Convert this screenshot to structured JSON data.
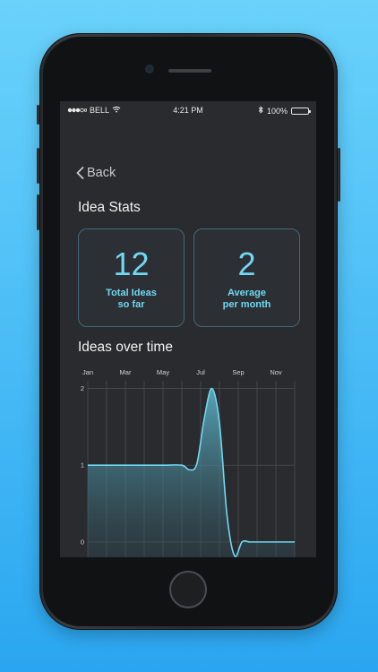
{
  "status_bar": {
    "carrier": "BELL",
    "time": "4:21 PM",
    "battery": "100%",
    "signal_icon": "signal-dots-icon",
    "wifi_icon": "wifi-icon",
    "bluetooth_icon": "bluetooth-icon"
  },
  "nav": {
    "back_label": "Back"
  },
  "stats": {
    "title": "Idea Stats",
    "total": {
      "value": "12",
      "label_line1": "Total Ideas",
      "label_line2": "so far"
    },
    "average": {
      "value": "2",
      "label_line1": "Average",
      "label_line2": "per month"
    }
  },
  "chart_section": {
    "title": "Ideas over time"
  },
  "colors": {
    "accent": "#6fd8f3",
    "screen_bg": "#2a2b2e",
    "card_border": "#3f6a7b",
    "background_gradient_top": "#6ad2fb",
    "background_gradient_bottom": "#2aa6f0"
  },
  "chart_data": {
    "type": "area",
    "title": "Ideas over time",
    "x_tick_labels": [
      "Jan",
      "Mar",
      "May",
      "Jul",
      "Sep",
      "Nov"
    ],
    "y_tick_labels": [
      "0",
      "1",
      "2"
    ],
    "ylim": [
      -0.2,
      2.1
    ],
    "xlim": [
      0,
      11
    ],
    "grid": true,
    "series": [
      {
        "x": [
          0,
          1,
          2,
          3,
          4,
          5,
          5.4,
          5.8,
          6.2,
          6.6,
          7.0,
          7.4,
          7.8,
          8.2,
          8.6,
          9,
          10,
          11
        ],
        "values": [
          1,
          1,
          1,
          1,
          1,
          1,
          0.94,
          1.02,
          1.62,
          2.0,
          1.55,
          0.35,
          -0.18,
          0.0,
          0.0,
          0.0,
          0.0,
          0.0
        ]
      }
    ]
  }
}
